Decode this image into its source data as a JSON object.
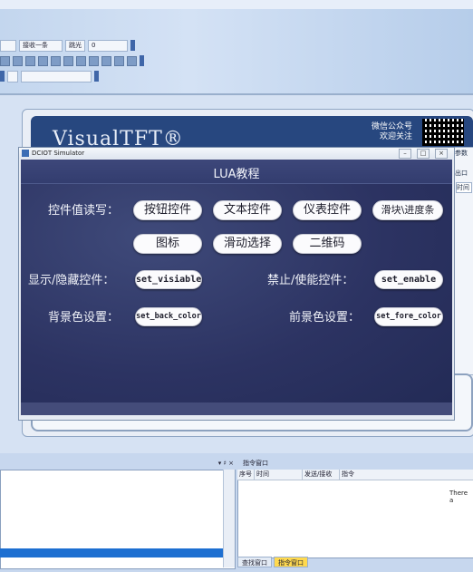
{
  "toolbar": {
    "combo_label": "接收一条",
    "step_label": "跳光",
    "step_value": "0"
  },
  "designer": {
    "banner_title": "VisualTFT®",
    "wechat_line1": "微信公众号",
    "wechat_line2": "欢迎关注",
    "right_panel_label": "参数",
    "right_panel_sub": "出口",
    "right_panel_row": "时间"
  },
  "simulator": {
    "window_title": "DCIOT Simulator",
    "screen_title": "LUA教程",
    "row1_label": "控件值读写：",
    "buttons_row1": [
      "按钮控件",
      "文本控件",
      "仪表控件",
      "滑块\\进度条"
    ],
    "buttons_row2": [
      "图标",
      "滑动选择",
      "二维码"
    ],
    "show_hide_label": "显示/隐藏控件：",
    "show_hide_button": "set_visiable",
    "enable_label": "禁止/使能控件：",
    "enable_button": "set_enable",
    "back_color_label": "背景色设置：",
    "back_color_button": "set_back_color",
    "fore_color_label": "前景色设置：",
    "fore_color_button": "set_fore_color"
  },
  "output": {
    "left_pin": "▾ ♯ ×",
    "right_title": "指令窗口",
    "columns": [
      "序号",
      "时间",
      "发送/接收",
      "指令"
    ],
    "partial_text": "There a",
    "tabs": [
      "查找窗口",
      "指令窗口"
    ]
  }
}
